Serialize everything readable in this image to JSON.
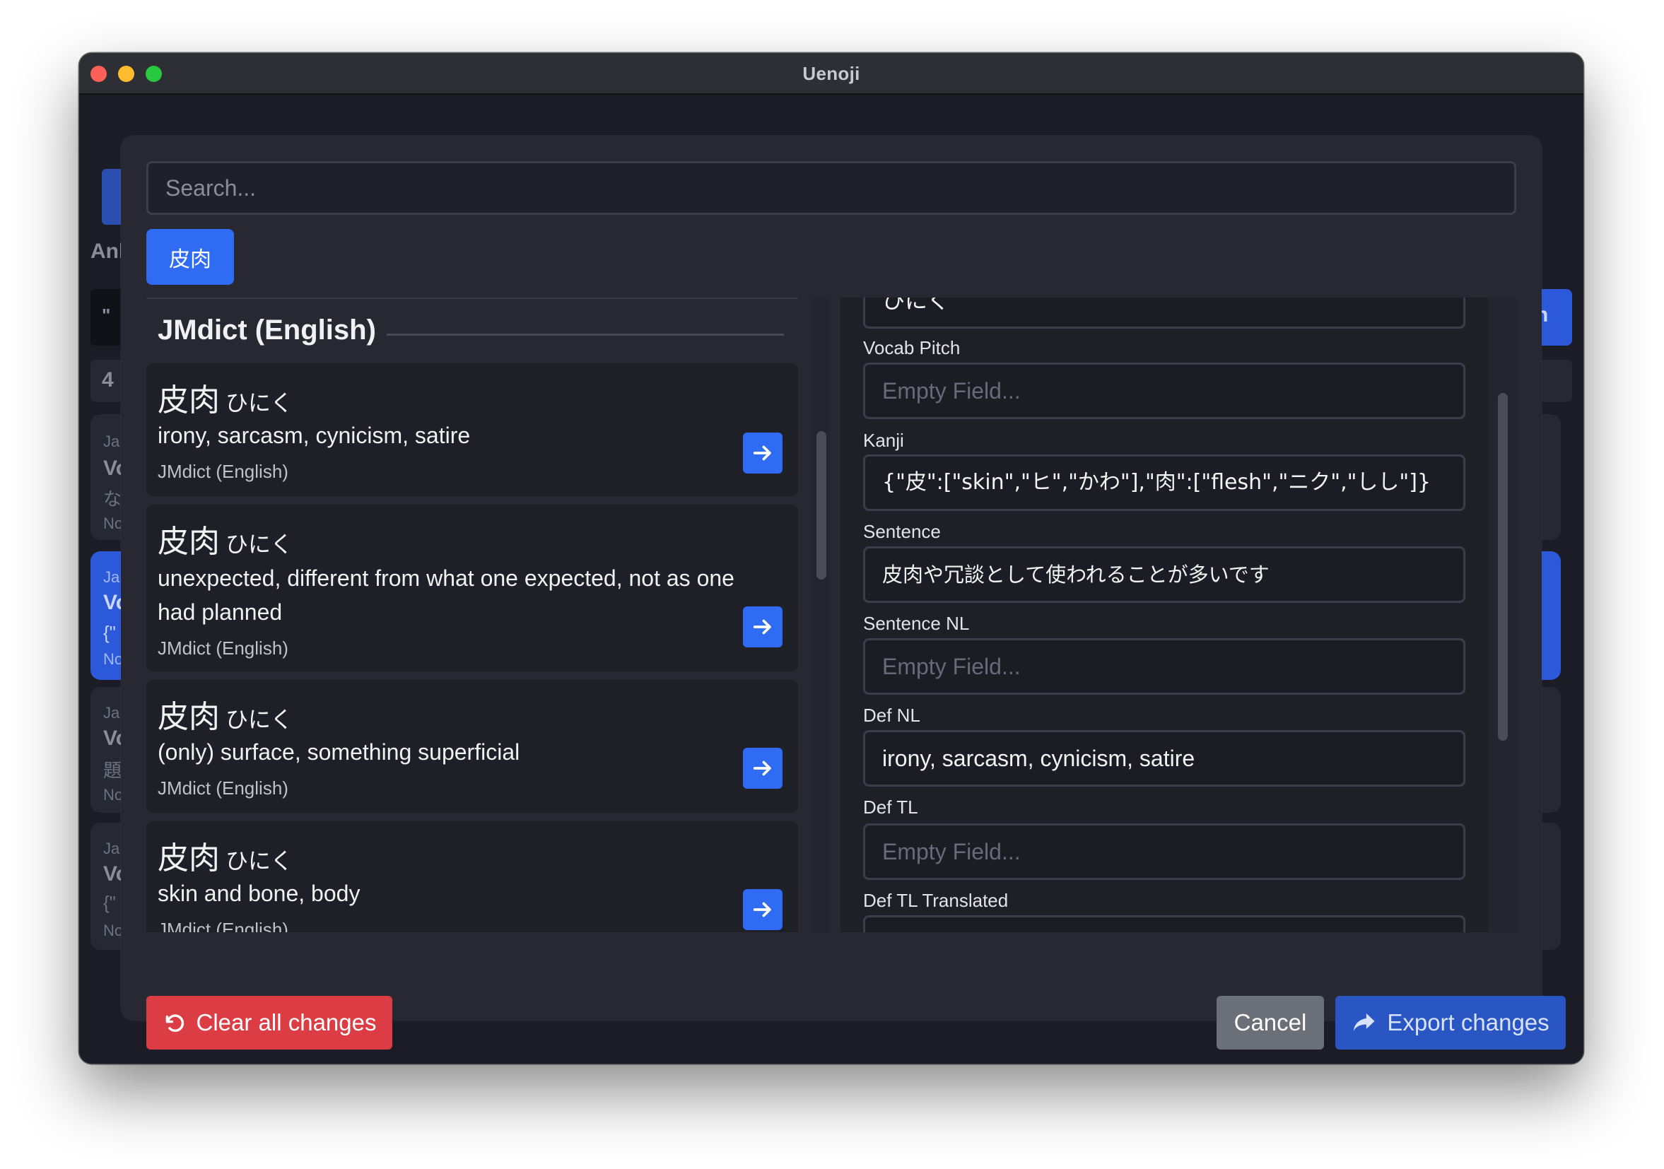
{
  "window": {
    "title": "Uenoji"
  },
  "background": {
    "fragments": [
      "Anl",
      "\"",
      "4",
      "Ja",
      "Vo",
      "な",
      "No",
      "Ja",
      "Vo",
      "{\"",
      "No",
      "Ja",
      "Vo",
      "題",
      "No",
      "Ja",
      "Vo",
      "{\"",
      "No",
      "h"
    ]
  },
  "modal": {
    "search_placeholder": "Search...",
    "term_button": "皮肉",
    "dictionary_header": "JMdict (English)",
    "results": [
      {
        "kanji": "皮肉",
        "kana": "ひにく",
        "definition": "irony, sarcasm, cynicism, satire",
        "source": "JMdict (English)"
      },
      {
        "kanji": "皮肉",
        "kana": "ひにく",
        "definition": "unexpected, different from what one expected, not as one had planned",
        "source": "JMdict (English)"
      },
      {
        "kanji": "皮肉",
        "kana": "ひにく",
        "definition": "(only) surface, something superficial",
        "source": "JMdict (English)"
      },
      {
        "kanji": "皮肉",
        "kana": "ひにく",
        "definition": "skin and bone, body",
        "source": "JMdict (English)"
      }
    ],
    "fields": {
      "top_partial_value": "ひにく",
      "vocab_pitch": {
        "label": "Vocab Pitch",
        "placeholder": "Empty Field...",
        "value": ""
      },
      "kanji": {
        "label": "Kanji",
        "value": "{\"皮\":[\"skin\",\"ヒ\",\"かわ\"],\"肉\":[\"flesh\",\"ニク\",\"しし\"]}"
      },
      "sentence": {
        "label": "Sentence",
        "value": "皮肉や冗談として使われることが多いです"
      },
      "sentence_nl": {
        "label": "Sentence NL",
        "placeholder": "Empty Field...",
        "value": ""
      },
      "def_nl": {
        "label": "Def NL",
        "value": "irony, sarcasm, cynicism, satire"
      },
      "def_tl": {
        "label": "Def TL",
        "placeholder": "Empty Field...",
        "value": ""
      },
      "def_tl_translated": {
        "label": "Def TL Translated",
        "value": ""
      }
    },
    "buttons": {
      "clear": "Clear all changes",
      "cancel": "Cancel",
      "export": "Export changes"
    }
  },
  "colors": {
    "accent": "#2f6cf3",
    "danger": "#dc3d45",
    "secondary": "#6b7078",
    "export": "#2a56c4"
  },
  "icons": [
    "arrow-right-icon",
    "undo-icon",
    "share-icon"
  ]
}
